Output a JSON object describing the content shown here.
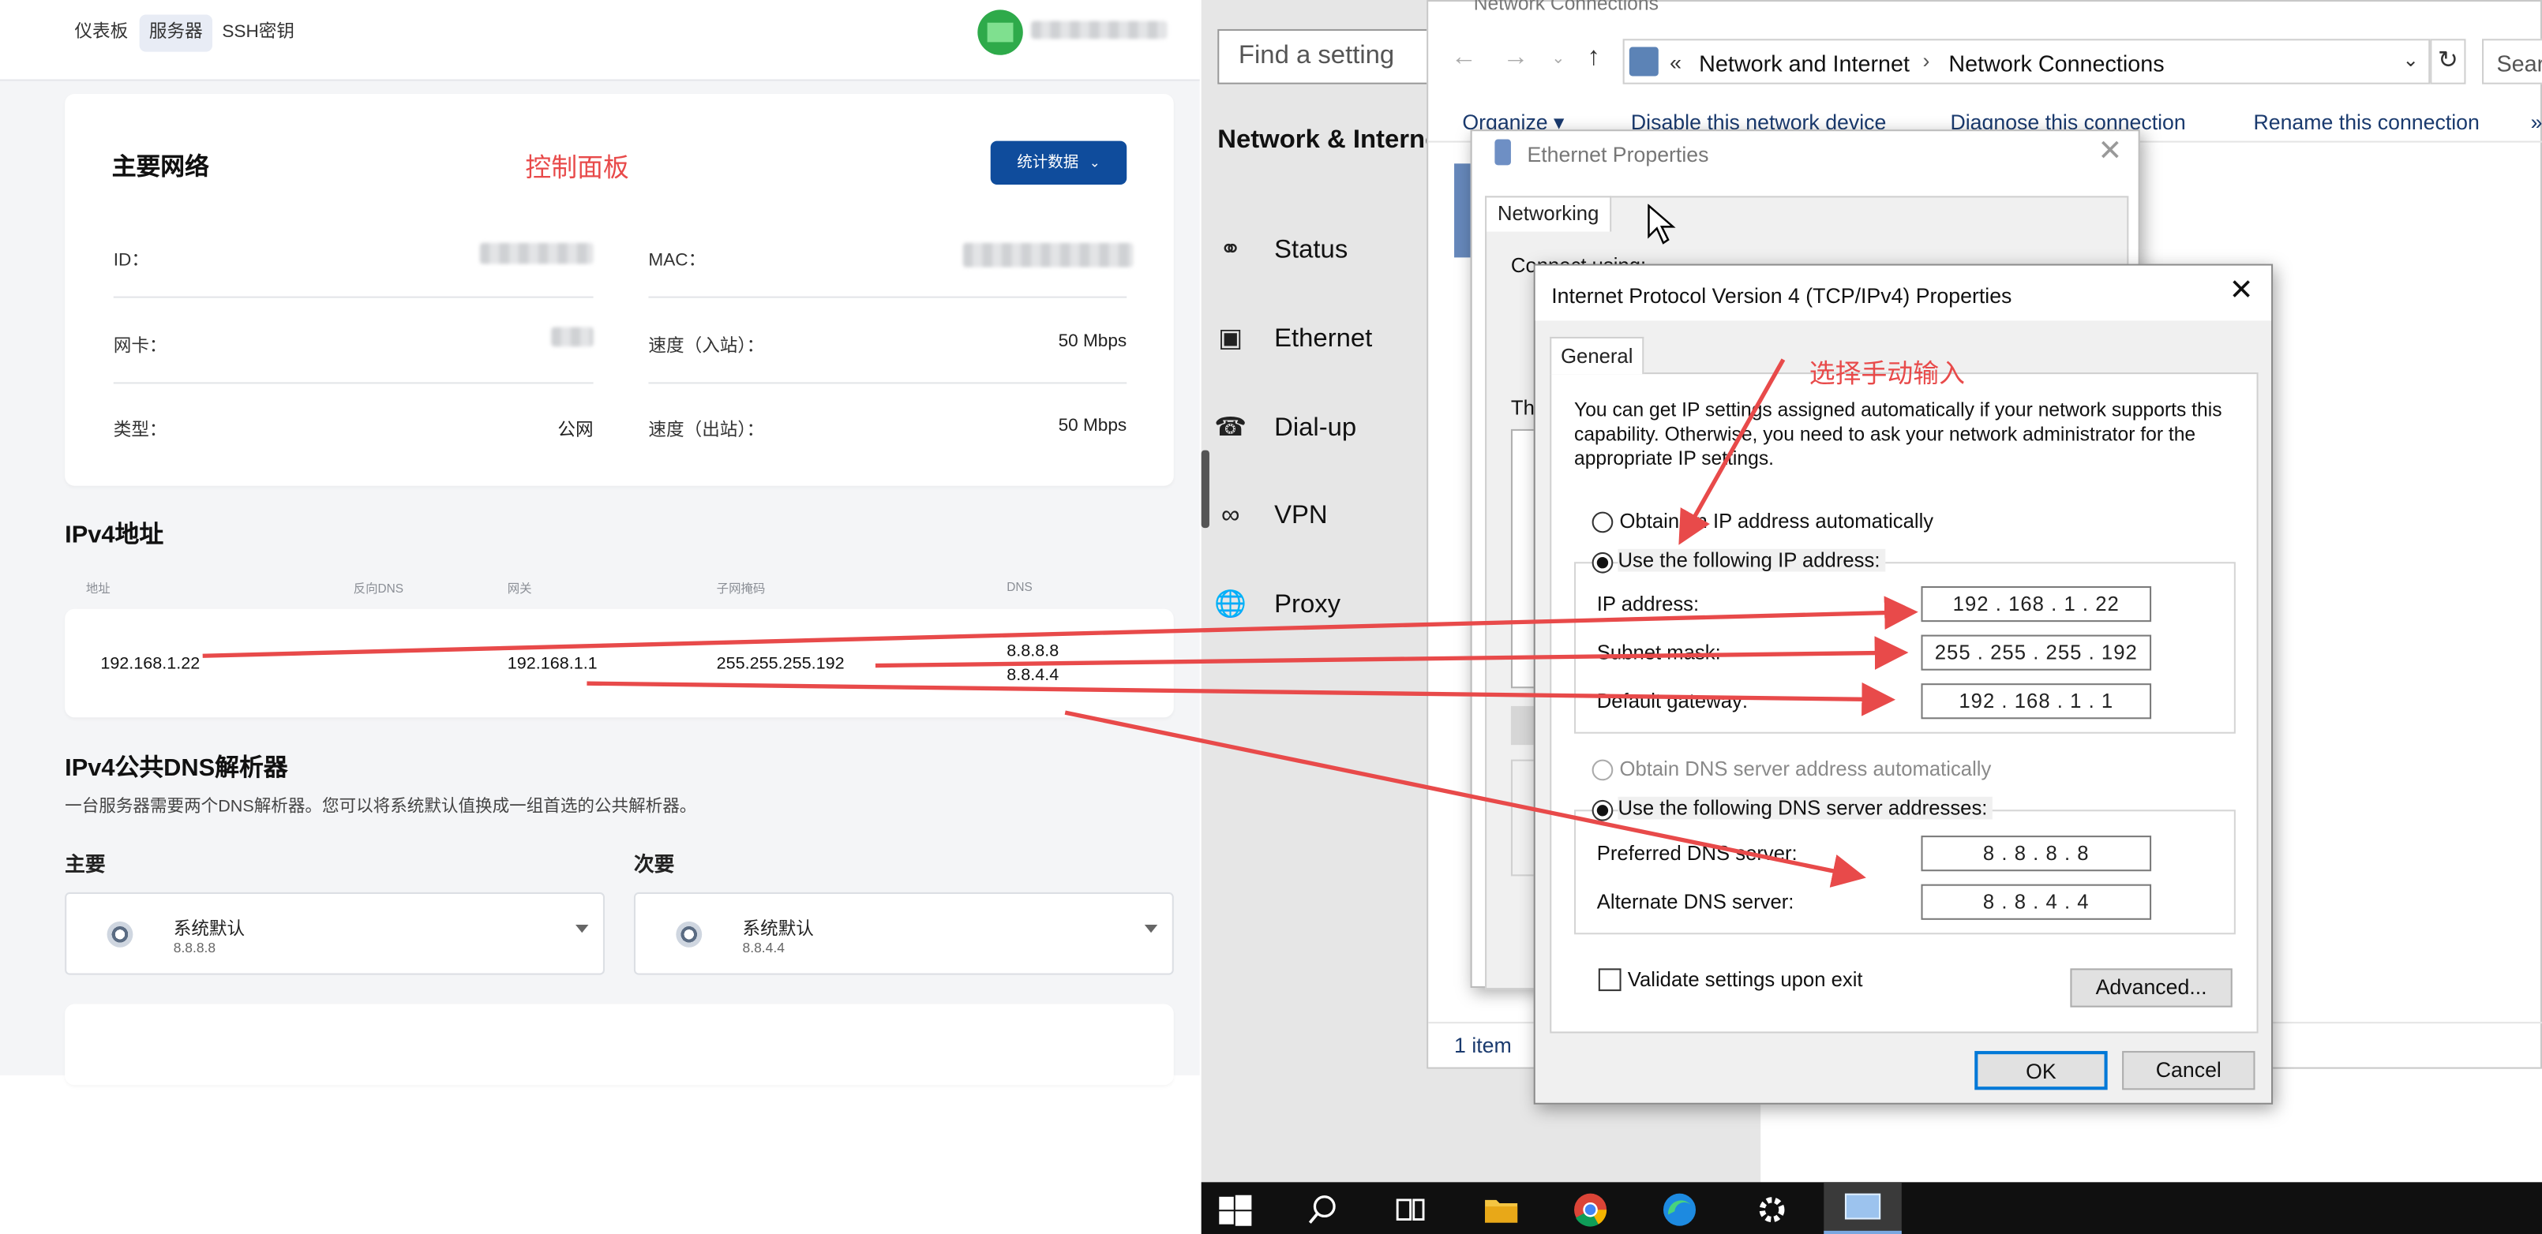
{
  "nav": {
    "tabs": [
      "仪表板",
      "服务器",
      "SSH密钥"
    ],
    "active": 1
  },
  "network_card": {
    "title": "主要网络",
    "annotation": "控制面板",
    "stats_button": "统计数据",
    "fields": [
      {
        "label": "ID：",
        "value": ""
      },
      {
        "label": "MAC：",
        "value": ""
      },
      {
        "label": "网卡：",
        "value": ""
      },
      {
        "label": "速度（入站）：",
        "value": "50 Mbps"
      },
      {
        "label": "类型：",
        "value": "公网"
      },
      {
        "label": "速度（出站）：",
        "value": "50 Mbps"
      }
    ]
  },
  "ipv4": {
    "title": "IPv4地址",
    "columns": [
      "地址",
      "反向DNS",
      "网关",
      "子网掩码",
      "DNS"
    ],
    "row": {
      "address": "192.168.1.22",
      "reverse_dns": "",
      "gateway": "192.168.1.1",
      "subnet": "255.255.255.192",
      "dns1": "8.8.8.8",
      "dns2": "8.8.4.4"
    }
  },
  "dns_resolver": {
    "title": "IPv4公共DNS解析器",
    "description": "一台服务器需要两个DNS解析器。您可以将系统默认值换成一组首选的公共解析器。",
    "primary_label": "主要",
    "secondary_label": "次要",
    "primary": {
      "name": "系统默认",
      "ip": "8.8.8.8"
    },
    "secondary": {
      "name": "系统默认",
      "ip": "8.8.4.4"
    }
  },
  "settings": {
    "search_placeholder": "Find a setting",
    "heading": "Network & Interne",
    "items": [
      "Status",
      "Ethernet",
      "Dial-up",
      "VPN",
      "Proxy"
    ]
  },
  "explorer": {
    "title": "Network Connections",
    "address_prefix": "«",
    "breadcrumb": [
      "Network and Internet",
      "Network Connections"
    ],
    "search_placeholder": "Sear",
    "toolbar": [
      "Organize ▾",
      "Disable this network device",
      "Diagnose this connection",
      "Rename this connection",
      "»"
    ],
    "status": "1 item"
  },
  "eth_props": {
    "title": "Ethernet Properties",
    "tab": "Networking",
    "connect_using": "Connect using:",
    "this_conn": "Th"
  },
  "ipv4_dialog": {
    "title": "Internet Protocol Version 4 (TCP/IPv4) Properties",
    "tab": "General",
    "annotation": "选择手动输入",
    "description": "You can get IP settings assigned automatically if your network supports this capability. Otherwise, you need to ask your network administrator for the appropriate IP settings.",
    "obtain_auto": "Obtain an IP address automatically",
    "use_following": "Use the following IP address:",
    "ip_label": "IP address:",
    "ip_value": "192 . 168 .  1  . 22",
    "subnet_label": "Subnet mask:",
    "subnet_value": "255 . 255 . 255 . 192",
    "gateway_label": "Default gateway:",
    "gateway_value": "192 . 168 .  1  .  1",
    "obtain_dns_auto": "Obtain DNS server address automatically",
    "use_dns": "Use the following DNS server addresses:",
    "pref_dns_label": "Preferred DNS server:",
    "pref_dns_value": "8  .  8  .  8  .  8",
    "alt_dns_label": "Alternate DNS server:",
    "alt_dns_value": "8  .  8  .  4  .  4",
    "validate": "Validate settings upon exit",
    "advanced": "Advanced...",
    "ok": "OK",
    "cancel": "Cancel"
  },
  "colors": {
    "accent_blue": "#0f4c9c",
    "annotation_red": "#e84a4a",
    "win_blue": "#0078d7"
  }
}
